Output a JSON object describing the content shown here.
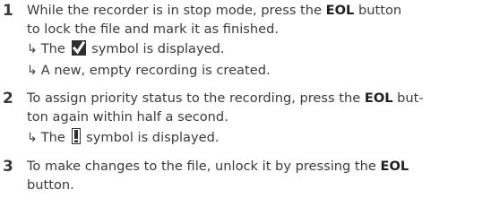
{
  "steps": [
    {
      "number": "1",
      "text_a": "While the recorder is in stop mode, press the ",
      "bold": "EOL",
      "text_b": " button",
      "text_c": "to lock the file and mark it as finished.",
      "result1_pre": "The",
      "result1_icon": "finished-check-icon",
      "result1_post": "symbol is displayed.",
      "result2": "A new, empty recording is created."
    },
    {
      "number": "2",
      "text_a": "To assign priority status to the recording, press the ",
      "bold": "EOL",
      "text_b": " but-",
      "text_c": "ton again within half a second.",
      "result1_pre": "The",
      "result1_icon": "priority-icon",
      "result1_post": "symbol is displayed."
    },
    {
      "number": "3",
      "text_a": "To make changes to the file, unlock it by pressing the ",
      "bold": "EOL",
      "text_c": "button."
    }
  ],
  "arrow_glyph": "↳",
  "icons": {
    "finished": "finished-check-icon",
    "priority": "priority-icon"
  }
}
